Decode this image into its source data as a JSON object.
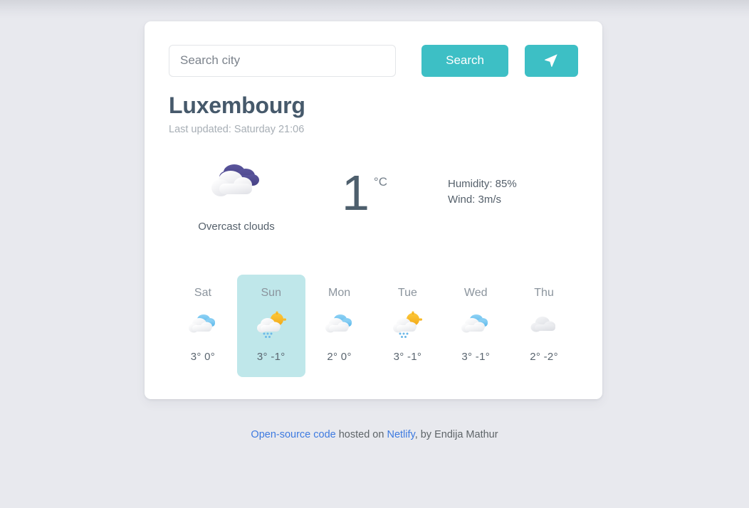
{
  "search": {
    "placeholder": "Search city",
    "value": "",
    "button_label": "Search",
    "geolocate_icon": "navigation-arrow-icon"
  },
  "location": {
    "city": "Luxembourg",
    "last_updated": "Last updated: Saturday 21:06"
  },
  "current": {
    "condition": "Overcast clouds",
    "condition_icon": "overcast-clouds-icon",
    "temperature": "1",
    "unit": "°C",
    "humidity": "Humidity: 85%",
    "wind": "Wind: 3m/s"
  },
  "forecast": [
    {
      "day": "Sat",
      "icon": "broken-clouds-icon",
      "temps": "3° 0°",
      "active": false
    },
    {
      "day": "Sun",
      "icon": "sun-cloud-sleet-icon",
      "temps": "3° -1°",
      "active": true
    },
    {
      "day": "Mon",
      "icon": "broken-clouds-icon",
      "temps": "2° 0°",
      "active": false
    },
    {
      "day": "Tue",
      "icon": "sun-cloud-sleet-icon",
      "temps": "3° -1°",
      "active": false
    },
    {
      "day": "Wed",
      "icon": "broken-clouds-icon",
      "temps": "3° -1°",
      "active": false
    },
    {
      "day": "Thu",
      "icon": "overcast-grey-cloud-icon",
      "temps": "2° -2°",
      "active": false
    }
  ],
  "footer": {
    "link1": "Open-source code",
    "mid": " hosted on ",
    "link2": "Netlify",
    "tail": ", by Endija Mathur"
  },
  "colors": {
    "accent": "#3dbfc5",
    "active_card": "#bfe7ea",
    "page_bg": "#e8e9ee",
    "card_bg": "#ffffff",
    "heading": "#46596b",
    "link": "#3d7ae0"
  }
}
